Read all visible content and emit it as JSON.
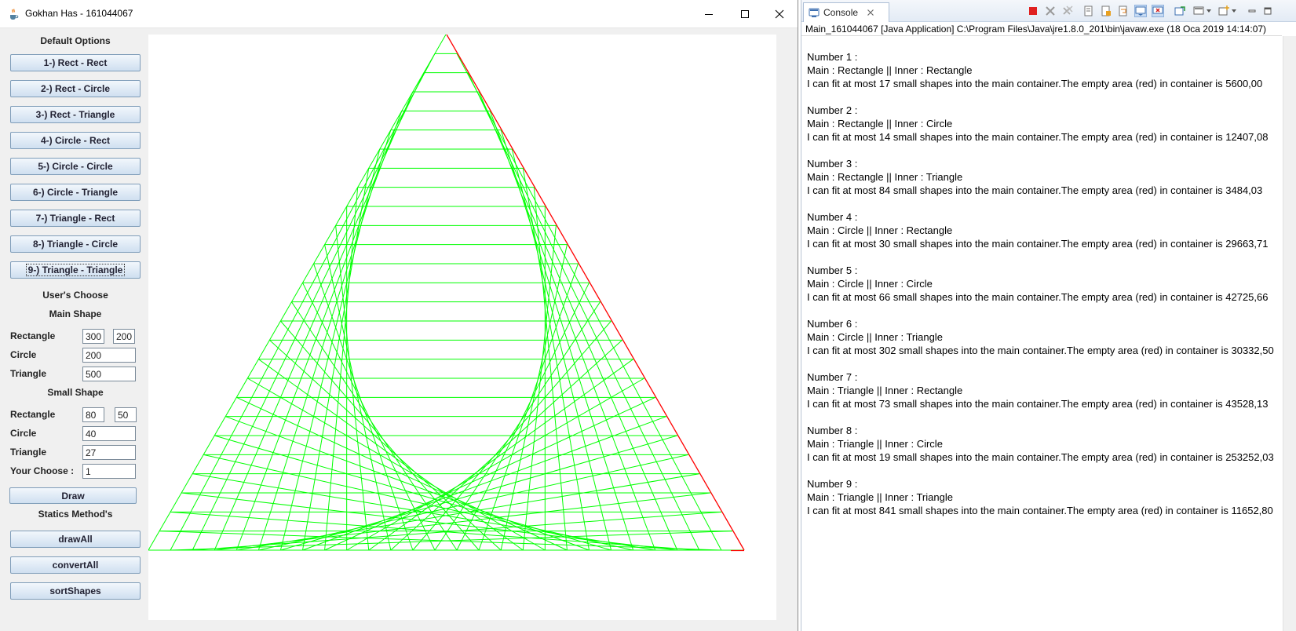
{
  "window": {
    "title": "Gokhan Has - 161044067"
  },
  "left_panel": {
    "default_title": "Default Options",
    "default_buttons": [
      "1-) Rect - Rect",
      "2-) Rect - Circle",
      "3-) Rect - Triangle",
      "4-) Circle - Rect",
      "5-) Circle - Circle",
      "6-) Circle - Triangle",
      "7-) Triangle - Rect",
      "8-) Triangle - Circle",
      "9-) Triangle - Triangle"
    ],
    "users_title": "User's Choose",
    "main_shape_title": "Main Shape",
    "main": {
      "rectangle_label": "Rectangle",
      "rect_w": "300",
      "rect_h": "200",
      "circle_label": "Circle",
      "circle_value": "200",
      "triangle_label": "Triangle",
      "triangle_value": "500"
    },
    "small_shape_title": "Small Shape",
    "small": {
      "rectangle_label": "Rectangle",
      "rect_w": "80",
      "rect_h": "50",
      "circle_label": "Circle",
      "circle_value": "40",
      "triangle_label": "Triangle",
      "triangle_value": "27"
    },
    "your_choose_label": "Your Choose :",
    "your_choose_value": "1",
    "draw_label": "Draw",
    "statics_title": "Statics Method's",
    "draw_all_label": "drawAll",
    "convert_all_label": "convertAll",
    "sort_shapes_label": "sortShapes"
  },
  "drawing": {
    "container_shape": "triangle",
    "grid_color": "#00ff00",
    "border_color": "#ff0000",
    "grid_rows": 27
  },
  "console": {
    "tab_label": "Console",
    "path": "Main_161044067 [Java Application] C:\\Program Files\\Java\\jre1.8.0_201\\bin\\javaw.exe (18 Oca 2019 14:14:07)",
    "entries": [
      {
        "header": "Number 1 :",
        "shapes": "Main : Rectangle || Inner : Rectangle",
        "result": "I can fit at most 17  small shapes into the main container.The empty area (red) in container is 5600,00"
      },
      {
        "header": "Number 2 :",
        "shapes": "Main : Rectangle || Inner : Circle",
        "result": "I can fit at most 14  small shapes into the main container.The empty area (red) in container is 12407,08"
      },
      {
        "header": "Number 3 :",
        "shapes": "Main : Rectangle || Inner : Triangle",
        "result": "I can fit at most 84  small shapes into the main container.The empty area (red) in container is 3484,03"
      },
      {
        "header": "Number 4 :",
        "shapes": "Main : Circle || Inner : Rectangle",
        "result": "I can fit at most 30  small shapes into the main container.The empty area (red) in container is 29663,71"
      },
      {
        "header": "Number 5 :",
        "shapes": "Main : Circle || Inner : Circle",
        "result": "I can fit at most 66  small shapes into the main container.The empty area (red) in container is 42725,66"
      },
      {
        "header": "Number 6 :",
        "shapes": "Main : Circle || Inner : Triangle",
        "result": "I can fit at most 302  small shapes into the main container.The empty area (red) in container is 30332,50"
      },
      {
        "header": "Number 7 :",
        "shapes": "Main : Triangle || Inner : Rectangle",
        "result": "I can fit at most 73  small shapes into the main container.The empty area (red) in container is 43528,13"
      },
      {
        "header": "Number 8 :",
        "shapes": "Main : Triangle || Inner : Circle",
        "result": "I can fit at most 19  small shapes into the main container.The empty area (red) in container is 253252,03"
      },
      {
        "header": "Number 9 :",
        "shapes": "Main : Triangle || Inner : Triangle",
        "result": "I can fit at most 841  small shapes into the main container.The empty area (red) in container is 11652,80"
      }
    ]
  }
}
